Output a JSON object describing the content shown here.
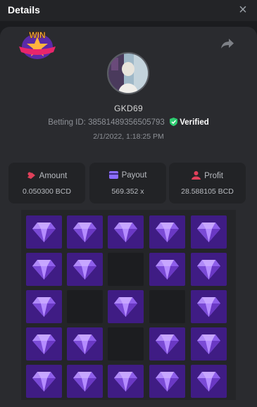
{
  "header": {
    "title": "Details",
    "close_icon": "×"
  },
  "badge": {
    "text": "WIN",
    "icon": "win-star-badge-icon"
  },
  "share": {
    "icon": "share-icon"
  },
  "user": {
    "name": "GKD69",
    "betting_id_label": "Betting ID:",
    "betting_id": "385814893565057​93",
    "verified_label": "Verified",
    "date": "2/1/2022, 1:18:25 PM"
  },
  "stats": [
    {
      "label": "Amount",
      "value": "0.050300 BCD",
      "icon": "amount-icon",
      "color": "#e0405a"
    },
    {
      "label": "Payout",
      "value": "569.352 x",
      "icon": "payout-icon",
      "color": "#8a6cff"
    },
    {
      "label": "Profit",
      "value": "28.588105 BCD",
      "icon": "profit-icon",
      "color": "#e0405a"
    }
  ],
  "grid": {
    "rows": [
      [
        "gem",
        "gem",
        "gem",
        "gem",
        "gem"
      ],
      [
        "gem",
        "gem",
        "empty",
        "gem",
        "gem"
      ],
      [
        "gem",
        "empty",
        "gem",
        "empty",
        "gem"
      ],
      [
        "gem",
        "gem",
        "empty",
        "gem",
        "gem"
      ],
      [
        "gem",
        "gem",
        "gem",
        "gem",
        "gem"
      ]
    ]
  },
  "colors": {
    "accent": "#3f1c84",
    "verified": "#2ecc71"
  }
}
